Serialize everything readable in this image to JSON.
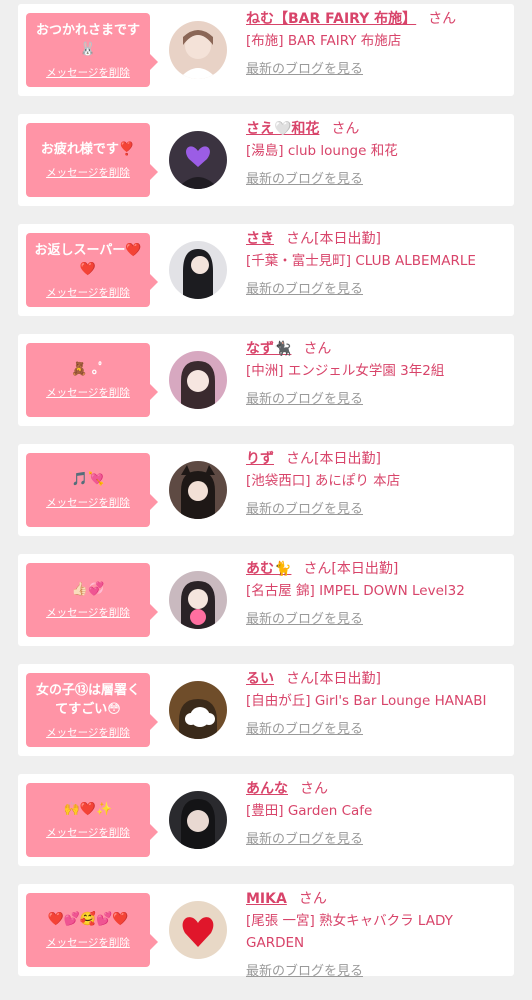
{
  "cards": [
    {
      "message": "おつかれさまです🐰",
      "delete_label": "メッセージを削除",
      "name": "ねむ【BAR FAIRY 布施】",
      "suffix": "さん",
      "shop": "[布施] BAR FAIRY 布施店",
      "blog_label": "最新のブログを見る",
      "avatar_color": "#e8d2c6"
    },
    {
      "message": "お疲れ様です❣️",
      "delete_label": "メッセージを削除",
      "name": "さえ🤍和花",
      "suffix": "さん",
      "shop": "[湯島] club lounge 和花",
      "blog_label": "最新のブログを見る",
      "avatar_color": "#3b3340"
    },
    {
      "message": "お返しスーパー❤️❤️",
      "delete_label": "メッセージを削除",
      "name": "さき",
      "suffix": "さん[本日出勤]",
      "shop": "[千葉・富士見町] CLUB ALBEMARLE",
      "blog_label": "最新のブログを見る",
      "avatar_color": "#e2e2e6"
    },
    {
      "message": "🧸 ｡ﾟ",
      "delete_label": "メッセージを削除",
      "name": "なず🐈‍⬛",
      "suffix": "さん",
      "shop": "[中洲] エンジェル女学園 3年2組",
      "blog_label": "最新のブログを見る",
      "avatar_color": "#d7a8c0"
    },
    {
      "message": "🎵💘",
      "delete_label": "メッセージを削除",
      "name": "りず",
      "suffix": "さん[本日出勤]",
      "shop": "[池袋西口] あにぽり 本店",
      "blog_label": "最新のブログを見る",
      "avatar_color": "#5e4a43"
    },
    {
      "message": "👍🏻💞",
      "delete_label": "メッセージを削除",
      "name": "あむ🐈",
      "suffix": "さん[本日出勤]",
      "shop": "[名古屋 錦] IMPEL DOWN Level32",
      "blog_label": "最新のブログを見る",
      "avatar_color": "#c9b9bf"
    },
    {
      "message": "女の子⑬は層署くてすごい😳",
      "delete_label": "メッセージを削除",
      "name": "るい",
      "suffix": "さん[本日出勤]",
      "shop": "[自由が丘] Girl's Bar Lounge HANABI",
      "blog_label": "最新のブログを見る",
      "avatar_color": "#6f4d2a"
    },
    {
      "message": "🙌❤️✨",
      "delete_label": "メッセージを削除",
      "name": "あんな",
      "suffix": "さん",
      "shop": "[豊田] Garden Cafe",
      "blog_label": "最新のブログを見る",
      "avatar_color": "#2a2a2e"
    },
    {
      "message": "❤️💕🥰💕❤️",
      "delete_label": "メッセージを削除",
      "name": "MIKA",
      "suffix": "さん",
      "shop": "[尾張 一宮] 熟女キャバクラ LADY GARDEN",
      "blog_label": "最新のブログを見る",
      "avatar_color": "#e8d8c6"
    }
  ]
}
